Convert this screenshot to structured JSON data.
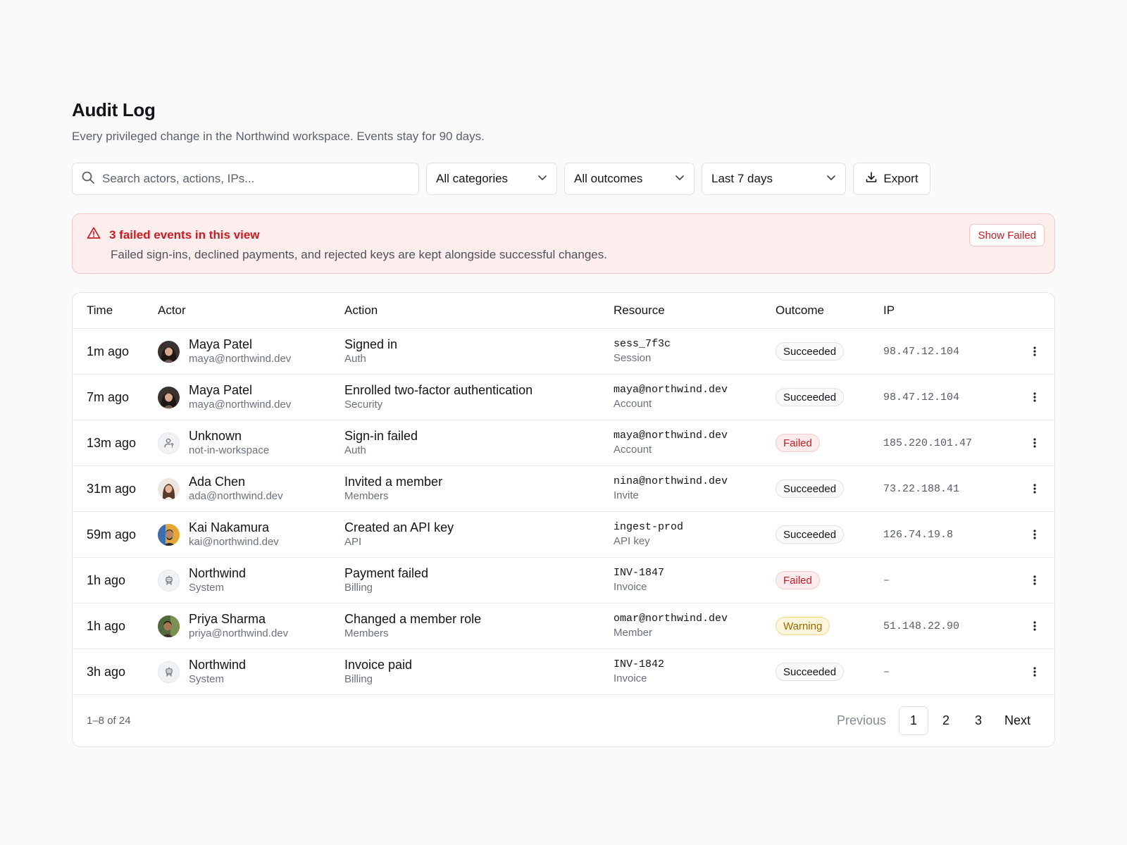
{
  "header": {
    "title": "Audit Log",
    "subtitle": "Every privileged change in the Northwind workspace. Events stay for 90 days."
  },
  "toolbar": {
    "search_placeholder": "Search actors, actions, IPs...",
    "category_value": "All categories",
    "outcome_value": "All outcomes",
    "date_value": "Last 7 days",
    "export_label": "Export"
  },
  "alert": {
    "title": "3 failed events in this view",
    "text": "Failed sign-ins, declined payments, and rejected keys are kept alongside successful changes.",
    "button": "Show Failed"
  },
  "table": {
    "columns": {
      "time": "Time",
      "actor": "Actor",
      "action": "Action",
      "resource": "Resource",
      "outcome": "Outcome",
      "ip": "IP"
    },
    "rows": [
      {
        "time": "1m ago",
        "actor": "Maya Patel",
        "actor_sub": "maya@northwind.dev",
        "avatar": "maya",
        "action": "Signed in",
        "action_sub": "Auth",
        "resource": "sess_7f3c",
        "resource_sub": "Session",
        "outcome": "Succeeded",
        "ip": "98.47.12.104"
      },
      {
        "time": "7m ago",
        "actor": "Maya Patel",
        "actor_sub": "maya@northwind.dev",
        "avatar": "maya",
        "action": "Enrolled two-factor authentication",
        "action_sub": "Security",
        "resource": "maya@northwind.dev",
        "resource_sub": "Account",
        "outcome": "Succeeded",
        "ip": "98.47.12.104"
      },
      {
        "time": "13m ago",
        "actor": "Unknown",
        "actor_sub": "not-in-workspace",
        "avatar": "unknown",
        "action": "Sign-in failed",
        "action_sub": "Auth",
        "resource": "maya@northwind.dev",
        "resource_sub": "Account",
        "outcome": "Failed",
        "ip": "185.220.101.47"
      },
      {
        "time": "31m ago",
        "actor": "Ada Chen",
        "actor_sub": "ada@northwind.dev",
        "avatar": "ada",
        "action": "Invited a member",
        "action_sub": "Members",
        "resource": "nina@northwind.dev",
        "resource_sub": "Invite",
        "outcome": "Succeeded",
        "ip": "73.22.188.41"
      },
      {
        "time": "59m ago",
        "actor": "Kai Nakamura",
        "actor_sub": "kai@northwind.dev",
        "avatar": "kai",
        "action": "Created an API key",
        "action_sub": "API",
        "resource": "ingest-prod",
        "resource_sub": "API key",
        "outcome": "Succeeded",
        "ip": "126.74.19.8"
      },
      {
        "time": "1h ago",
        "actor": "Northwind",
        "actor_sub": "System",
        "avatar": "system",
        "action": "Payment failed",
        "action_sub": "Billing",
        "resource": "INV-1847",
        "resource_sub": "Invoice",
        "outcome": "Failed",
        "ip": "–"
      },
      {
        "time": "1h ago",
        "actor": "Priya Sharma",
        "actor_sub": "priya@northwind.dev",
        "avatar": "priya",
        "action": "Changed a member role",
        "action_sub": "Members",
        "resource": "omar@northwind.dev",
        "resource_sub": "Member",
        "outcome": "Warning",
        "ip": "51.148.22.90"
      },
      {
        "time": "3h ago",
        "actor": "Northwind",
        "actor_sub": "System",
        "avatar": "system",
        "action": "Invoice paid",
        "action_sub": "Billing",
        "resource": "INV-1842",
        "resource_sub": "Invoice",
        "outcome": "Succeeded",
        "ip": "–"
      }
    ]
  },
  "footer": {
    "range": "1–8 of 24",
    "previous": "Previous",
    "pages": [
      "1",
      "2",
      "3"
    ],
    "next": "Next"
  },
  "colors": {
    "danger": "#c51d24",
    "alert_bg": "#fdeded",
    "warning_text": "#9a6a00",
    "warning_bg": "#fdf6dd"
  }
}
